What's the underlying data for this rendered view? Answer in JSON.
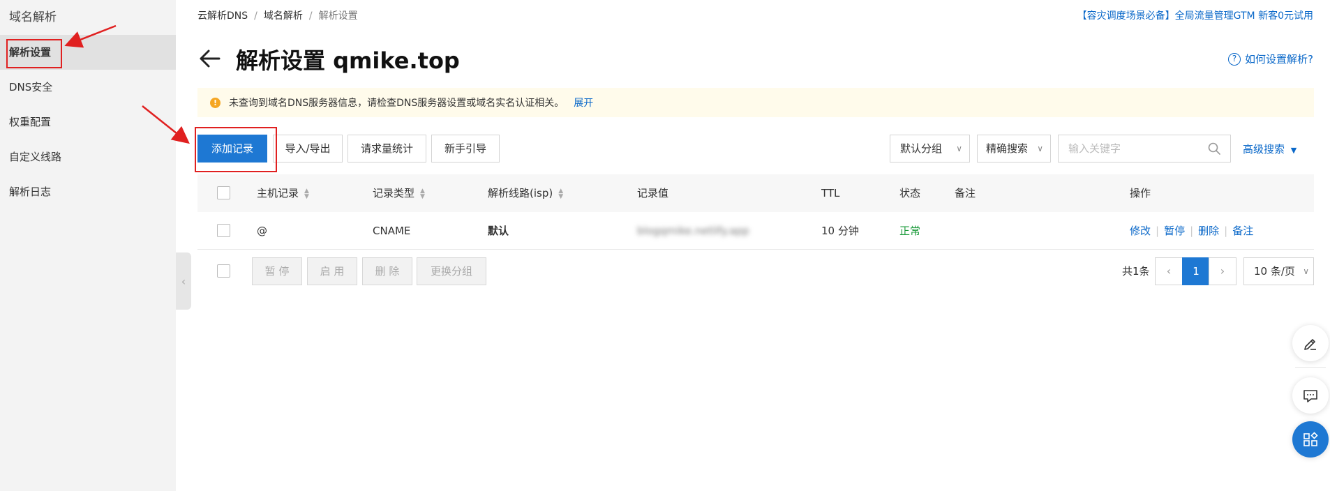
{
  "sidebar": {
    "title": "域名解析",
    "items": [
      {
        "label": "解析设置",
        "active": true
      },
      {
        "label": "DNS安全"
      },
      {
        "label": "权重配置"
      },
      {
        "label": "自定义线路"
      },
      {
        "label": "解析日志"
      }
    ]
  },
  "breadcrumb": [
    "云解析DNS",
    "域名解析",
    "解析设置"
  ],
  "promo": "【容灾调度场景必备】全局流量管理GTM 新客0元试用",
  "page": {
    "title": "解析设置 qmike.top",
    "help_link": "如何设置解析?"
  },
  "notice": {
    "text": "未查询到域名DNS服务器信息，请检查DNS服务器设置或域名实名认证相关。",
    "expand": "展开"
  },
  "toolbar": {
    "add_record": "添加记录",
    "import_export": "导入/导出",
    "request_stats": "请求量统计",
    "beginner_guide": "新手引导",
    "group_select": "默认分组",
    "search_mode": "精确搜索",
    "search_placeholder": "输入关键字",
    "advanced_search": "高级搜索"
  },
  "table": {
    "headers": [
      "主机记录",
      "记录类型",
      "解析线路(isp)",
      "记录值",
      "TTL",
      "状态",
      "备注",
      "操作"
    ],
    "rows": [
      {
        "host": "@",
        "type": "CNAME",
        "line": "默认",
        "value": "blogqmike.netlify.app",
        "ttl": "10 分钟",
        "status": "正常",
        "remark": "",
        "actions": [
          "修改",
          "暂停",
          "删除",
          "备注"
        ]
      }
    ]
  },
  "batch": {
    "pause": "暂 停",
    "enable": "启 用",
    "delete": "删 除",
    "change_group": "更换分组"
  },
  "pagination": {
    "total": "共1条",
    "current_page": "1",
    "page_size": "10 条/页"
  },
  "colors": {
    "accent": "#1e78d3",
    "link": "#0a68c9",
    "status_ok": "#1a9a3a",
    "annotation": "#e02020",
    "notice_bg": "#fffbeb"
  },
  "icons": [
    "back-arrow-icon",
    "help-icon",
    "warning-icon",
    "search-icon",
    "chevron-down-icon",
    "sort-icon",
    "edit-icon",
    "chat-icon",
    "apps-icon",
    "collapse-icon"
  ]
}
